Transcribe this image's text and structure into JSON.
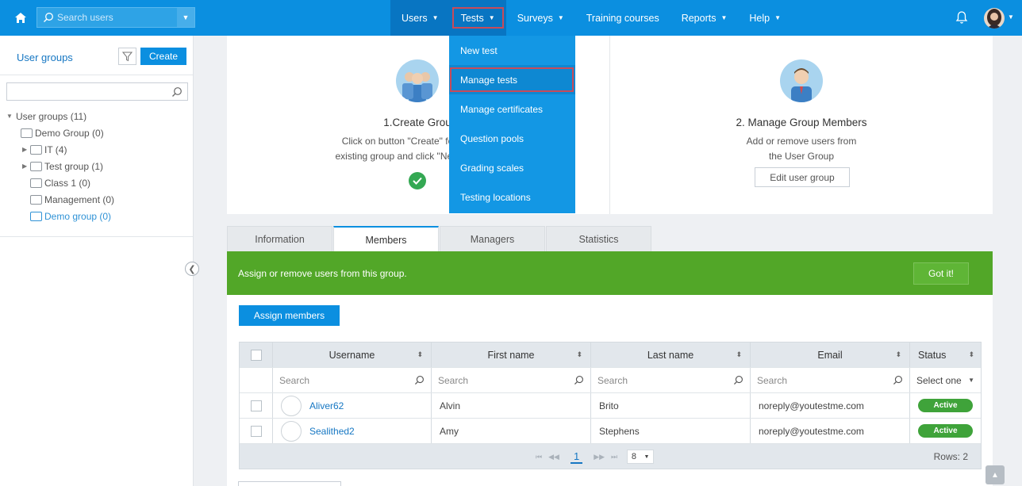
{
  "topbar": {
    "search_placeholder": "Search users",
    "nav": [
      {
        "label": "Users"
      },
      {
        "label": "Tests"
      },
      {
        "label": "Surveys"
      },
      {
        "label": "Training courses"
      },
      {
        "label": "Reports"
      },
      {
        "label": "Help"
      }
    ]
  },
  "sidebar": {
    "title": "User groups",
    "create_label": "Create",
    "tree": {
      "root": "User groups (11)",
      "items": [
        {
          "label": "Demo Group (0)",
          "expandable": false
        },
        {
          "label": "IT (4)",
          "expandable": true
        },
        {
          "label": "Test group (1)",
          "expandable": true
        },
        {
          "label": "Class 1 (0)",
          "expandable": false
        },
        {
          "label": "Management (0)",
          "expandable": false
        },
        {
          "label": "Demo group (0)",
          "expandable": false,
          "selected": true
        }
      ]
    }
  },
  "tests_menu": {
    "items": [
      "New test",
      "Manage tests",
      "Manage certificates",
      "Question pools",
      "Grading scales",
      "Testing locations"
    ],
    "highlighted": "Manage tests"
  },
  "cards": {
    "create": {
      "title": "1.Create Grou",
      "line1": "Click on button \"Create\" for creating",
      "line2": "existing group and click \"New sub-grou"
    },
    "manage": {
      "title": "2. Manage Group Members",
      "line1": "Add or remove users from",
      "line2": "the User Group",
      "button": "Edit user group"
    }
  },
  "tabs": [
    "Information",
    "Members",
    "Managers",
    "Statistics"
  ],
  "active_tab": "Members",
  "banner": {
    "text": "Assign or remove users from this group.",
    "button": "Got it!"
  },
  "assign_label": "Assign members",
  "grid": {
    "columns": [
      "Username",
      "First name",
      "Last name",
      "Email",
      "Status"
    ],
    "filter_placeholder": "Search",
    "status_filter": "Select one",
    "rows": [
      {
        "username": "Aliver62",
        "first": "Alvin",
        "last": "Brito",
        "email": "noreply@youtestme.com",
        "status": "Active"
      },
      {
        "username": "Sealithed2",
        "first": "Amy",
        "last": "Stephens",
        "email": "noreply@youtestme.com",
        "status": "Active"
      }
    ],
    "page": "1",
    "page_size": "8",
    "rows_label": "Rows: 2"
  },
  "colors": {
    "primary": "#0b8fe0",
    "banner_green": "#52a728",
    "active_badge": "#3fa33a",
    "highlight_red": "#c84b5a"
  }
}
